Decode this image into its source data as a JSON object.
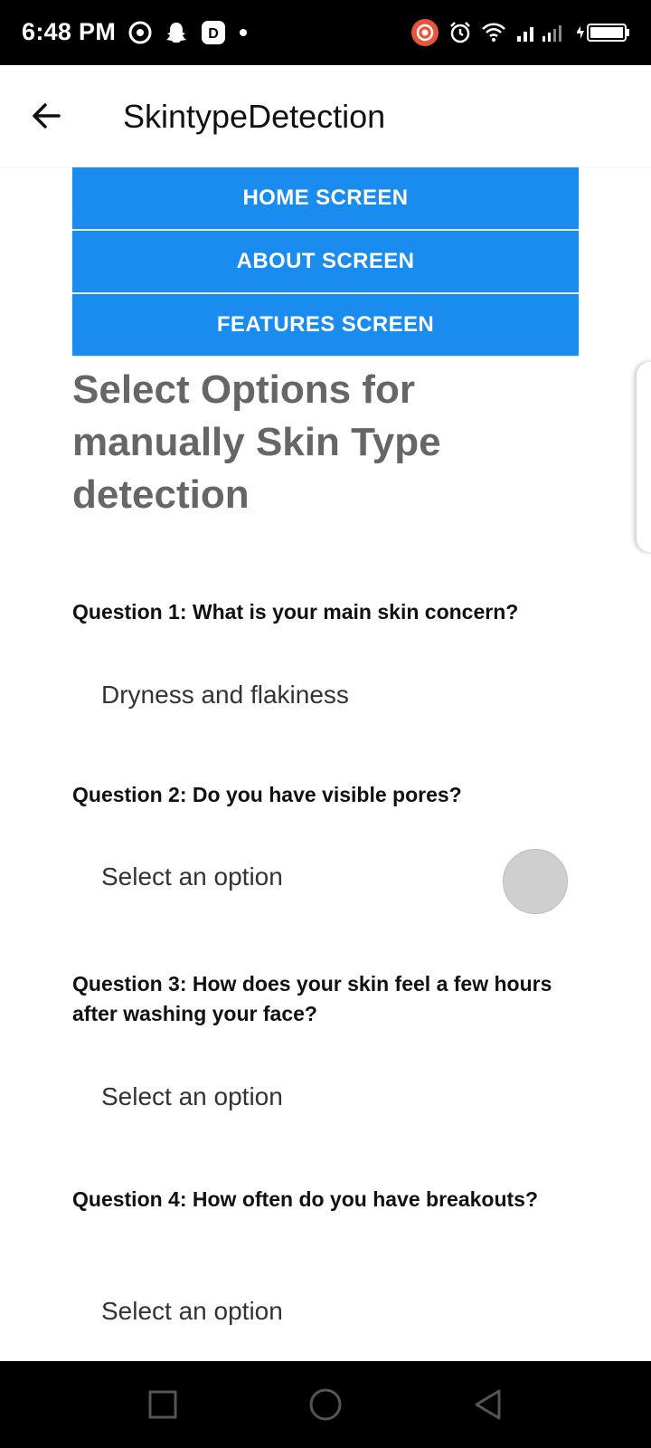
{
  "status_bar": {
    "time": "6:48 PM",
    "battery": "88",
    "icons": [
      "camera-icon",
      "snapchat-icon",
      "app-icon",
      "dot-icon",
      "recording-icon",
      "alarm-icon",
      "wifi-icon",
      "signal-icon",
      "battery-icon"
    ]
  },
  "app_bar": {
    "title": "SkintypeDetection"
  },
  "nav_buttons": {
    "home": "HOME SCREEN",
    "about": "ABOUT SCREEN",
    "features": "FEATURES SCREEN"
  },
  "heading": "Select Options for manually Skin Type detection",
  "questions": [
    {
      "label": "Question 1: What is your main skin concern?",
      "value": "Dryness and flakiness"
    },
    {
      "label": "Question 2: Do you have visible pores?",
      "value": "Select an option"
    },
    {
      "label": "Question 3: How does your skin feel a few hours after washing your face?",
      "value": "Select an option"
    },
    {
      "label": "Question 4: How often do you have breakouts?",
      "value": "Select an option"
    }
  ],
  "colors": {
    "accent": "#1a8cf0",
    "heading": "#666666"
  }
}
